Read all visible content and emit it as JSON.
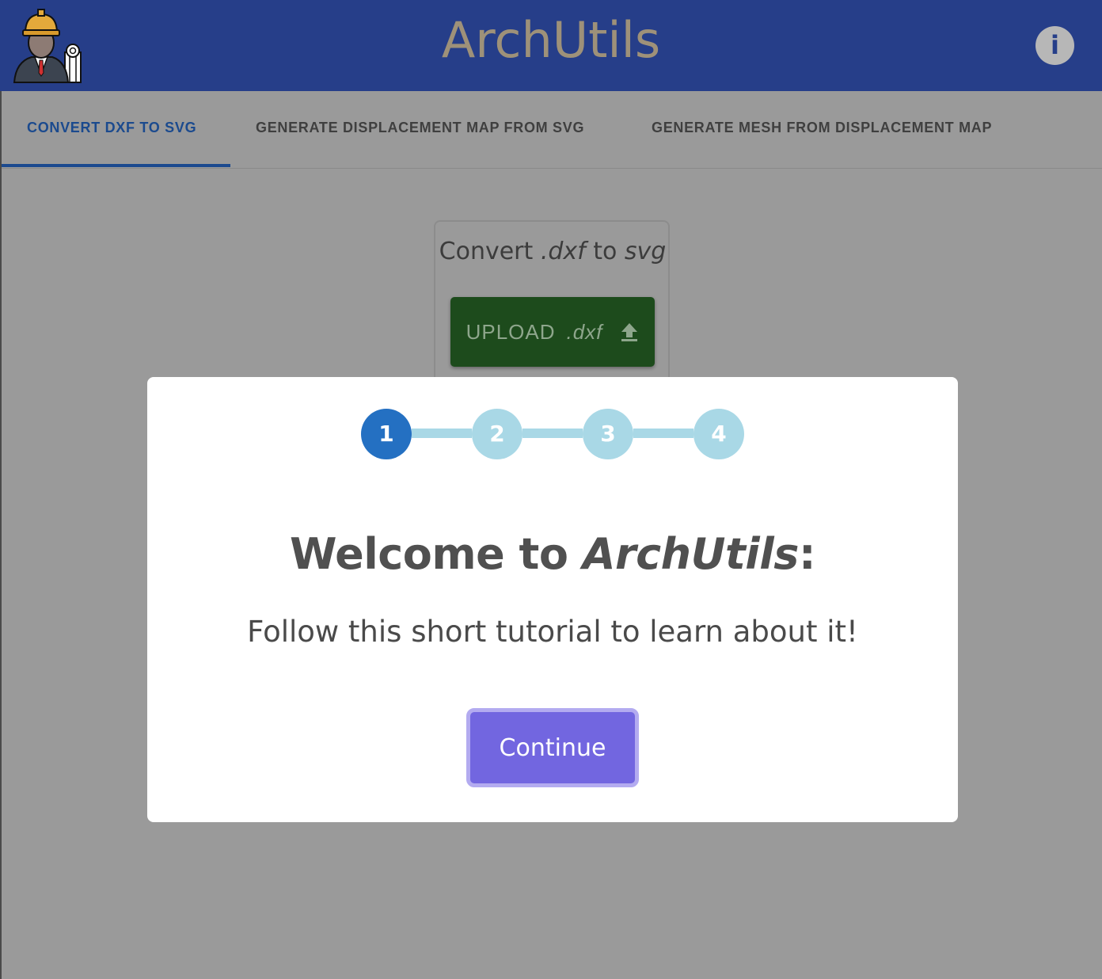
{
  "app": {
    "title": "ArchUtils",
    "logo_icon": "architect-icon",
    "info_icon": "info-icon",
    "info_label": "i",
    "colors": {
      "appbar": "#263e89",
      "title": "#9e9179",
      "overlay": "#9a9a9a",
      "active_tab": "#1b4a8e"
    }
  },
  "tabs": [
    {
      "label": "CONVERT DXF TO SVG",
      "active": true
    },
    {
      "label": "GENERATE DISPLACEMENT MAP FROM SVG",
      "active": false
    },
    {
      "label": "GENERATE MESH FROM DISPLACEMENT MAP",
      "active": false
    }
  ],
  "card": {
    "title_prefix": "Convert ",
    "title_ext": ".dxf",
    "title_mid": " to ",
    "title_target": "svg",
    "upload_label": "UPLOAD",
    "upload_ext": ".dxf",
    "upload_icon": "upload-icon",
    "upload_color": "#1d4b1c"
  },
  "tutorial": {
    "steps": [
      "1",
      "2",
      "3",
      "4"
    ],
    "current_step": 1,
    "heading_prefix": "Welcome to ",
    "heading_app": "ArchUtils",
    "heading_suffix": ":",
    "subtitle": "Follow this short tutorial to learn about it!",
    "continue_label": "Continue",
    "colors": {
      "step_active": "#2470c2",
      "step_inactive": "#a9d8e6",
      "continue": "#7266e0"
    }
  }
}
